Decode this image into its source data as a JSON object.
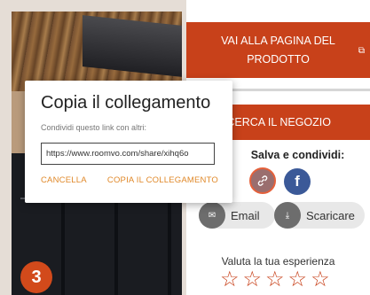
{
  "background": {
    "photo_step": "3"
  },
  "product_panel": {
    "product_button_label": "VAI ALLA PAGINA DEL PRODOTTO",
    "store_button_label": "CERCA IL NEGOZIO",
    "share_title": "Salva e condividi:",
    "facebook_letter": "f",
    "email_label": "Email",
    "download_label": "Scaricare",
    "rating_prompt": "Valuta la tua esperienza",
    "stars": [
      "☆",
      "☆",
      "☆",
      "☆",
      "☆"
    ]
  },
  "dialog": {
    "title": "Copia il collegamento",
    "subtitle": "Condividi questo link con altri:",
    "link_value": "https://www.roomvo.com/share/xihq6o",
    "cancel_label": "CANCELLA",
    "copy_label": "COPIA IL COLLEGAMENTO"
  },
  "colors": {
    "accent": "#c8411a",
    "facebook": "#3b5998",
    "dialog_link": "#e0892a"
  }
}
